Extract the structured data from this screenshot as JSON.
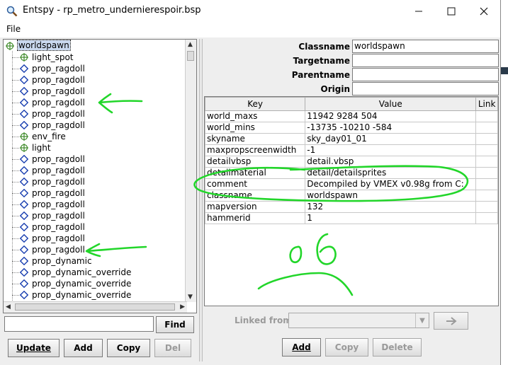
{
  "window": {
    "title": "Entspy - rp_metro_undernierespoir.bsp",
    "controls": [
      "minimize-icon",
      "maximize-icon",
      "close-icon"
    ]
  },
  "menu": {
    "file": "File"
  },
  "tree": {
    "root": "worldspawn",
    "items": [
      {
        "label": "light_spot",
        "icon": "point-entity-icon"
      },
      {
        "label": "prop_ragdoll",
        "icon": "brush-entity-icon"
      },
      {
        "label": "prop_ragdoll",
        "icon": "brush-entity-icon"
      },
      {
        "label": "prop_ragdoll",
        "icon": "brush-entity-icon"
      },
      {
        "label": "prop_ragdoll",
        "icon": "brush-entity-icon"
      },
      {
        "label": "prop_ragdoll",
        "icon": "brush-entity-icon"
      },
      {
        "label": "prop_ragdoll",
        "icon": "brush-entity-icon"
      },
      {
        "label": "env_fire",
        "icon": "point-entity-icon"
      },
      {
        "label": "light",
        "icon": "point-entity-icon"
      },
      {
        "label": "prop_ragdoll",
        "icon": "brush-entity-icon"
      },
      {
        "label": "prop_ragdoll",
        "icon": "brush-entity-icon"
      },
      {
        "label": "prop_ragdoll",
        "icon": "brush-entity-icon"
      },
      {
        "label": "prop_ragdoll",
        "icon": "brush-entity-icon"
      },
      {
        "label": "prop_ragdoll",
        "icon": "brush-entity-icon"
      },
      {
        "label": "prop_ragdoll",
        "icon": "brush-entity-icon"
      },
      {
        "label": "prop_ragdoll",
        "icon": "brush-entity-icon"
      },
      {
        "label": "prop_ragdoll",
        "icon": "brush-entity-icon"
      },
      {
        "label": "prop_ragdoll",
        "icon": "brush-entity-icon"
      },
      {
        "label": "prop_dynamic",
        "icon": "brush-entity-icon"
      },
      {
        "label": "prop_dynamic_override",
        "icon": "brush-entity-icon"
      },
      {
        "label": "prop_dynamic_override",
        "icon": "brush-entity-icon"
      },
      {
        "label": "prop_dynamic_override",
        "icon": "brush-entity-icon"
      }
    ]
  },
  "search": {
    "value": "",
    "find_label": "Find"
  },
  "left_buttons": {
    "update": "Update",
    "add": "Add",
    "copy": "Copy",
    "del": "Del"
  },
  "props": {
    "classname_label": "Classname",
    "classname_value": "worldspawn",
    "targetname_label": "Targetname",
    "targetname_value": "",
    "parentname_label": "Parentname",
    "parentname_value": "",
    "origin_label": "Origin",
    "origin_value": ""
  },
  "kv_table": {
    "headers": [
      "Key",
      "Value",
      "Link"
    ],
    "rows": [
      {
        "key": "world_maxs",
        "value": "11942 9284 504"
      },
      {
        "key": "world_mins",
        "value": "-13735 -10210 -584"
      },
      {
        "key": "skyname",
        "value": "sky_day01_01"
      },
      {
        "key": "maxpropscreenwidth",
        "value": "-1"
      },
      {
        "key": "detailvbsp",
        "value": "detail.vbsp"
      },
      {
        "key": "detailmaterial",
        "value": "detail/detailsprites"
      },
      {
        "key": "comment",
        "value": "Decompiled by VMEX v0.98g from C:"
      },
      {
        "key": "classname",
        "value": "worldspawn"
      },
      {
        "key": "mapversion",
        "value": "132"
      },
      {
        "key": "hammerid",
        "value": "1"
      }
    ]
  },
  "linked": {
    "label": "Linked from",
    "value": ""
  },
  "right_buttons": {
    "add": "Add",
    "copy": "Copy",
    "delete": "Delete"
  },
  "annotation_text": "o6",
  "colors": {
    "annotation": "#22d62a",
    "selection": "#c9d8ee",
    "brush_icon": "#1a3fb0",
    "point_icon": "#3f8a2a"
  }
}
